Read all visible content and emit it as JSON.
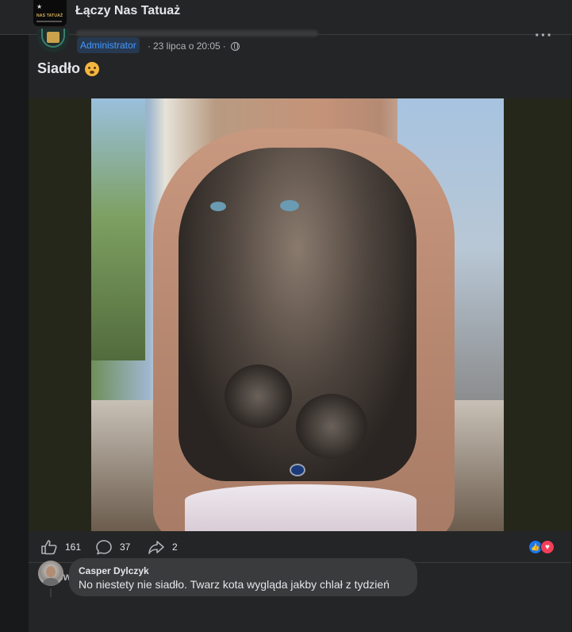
{
  "header": {
    "group_name": "Łączy Nas Tatuaż",
    "thumb_logo_text": "NAS TATUAŻ"
  },
  "post": {
    "badge": "Administrator",
    "meta_separator": "·",
    "timestamp": "23 lipca o 20:05",
    "privacy_icon": "globe-icon",
    "caption": "Siadło",
    "caption_emoji": "exploding-head-emoji",
    "image": {
      "description_icon": "tattoo-photo"
    }
  },
  "actions": {
    "likes": "161",
    "comments": "37",
    "shares": "2",
    "reaction_icons": [
      "like-reaction-icon",
      "love-reaction-icon"
    ],
    "like_color": "#1877f2",
    "love_color": "#f33e58"
  },
  "comments": {
    "view_more_label": "Wyświetl więcej komentarzy",
    "items": [
      {
        "author": "Casper Dylczyk",
        "text": "No niestety nie siadło. Twarz kota wygląda jakby chlał z tydzień"
      }
    ]
  },
  "colors": {
    "page_bg": "#18191a",
    "card_bg": "#242526",
    "accent": "#4599ff",
    "text_primary": "#e4e6eb",
    "text_secondary": "#b0b3b8"
  }
}
